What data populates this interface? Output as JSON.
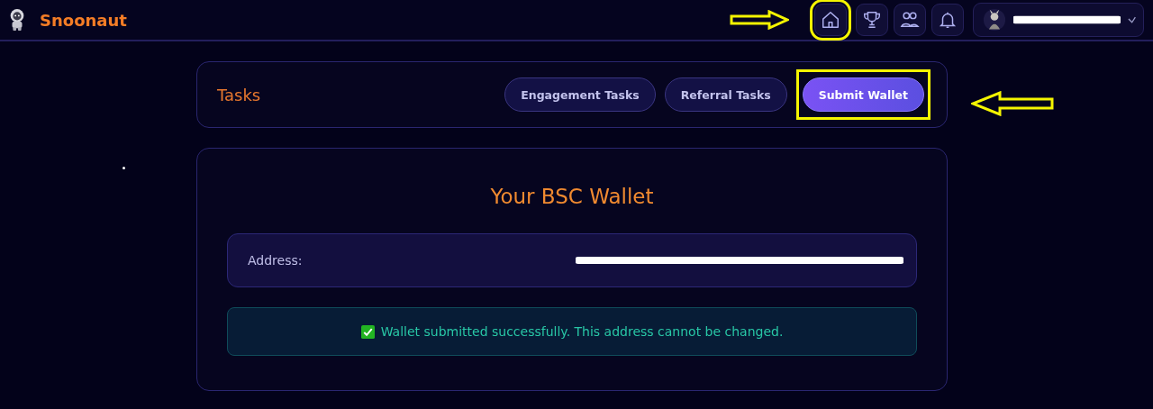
{
  "header": {
    "brand": "Snoonaut",
    "nav": [
      {
        "kind": "home",
        "highlighted": true
      },
      {
        "kind": "trophy",
        "highlighted": false
      },
      {
        "kind": "people",
        "highlighted": false
      },
      {
        "kind": "bell",
        "highlighted": false
      }
    ],
    "user": {
      "name_redacted": true
    }
  },
  "tasks": {
    "title": "Tasks",
    "tabs": [
      {
        "label": "Engagement Tasks",
        "selected": false,
        "highlighted": false
      },
      {
        "label": "Referral Tasks",
        "selected": false,
        "highlighted": false
      },
      {
        "label": "Submit Wallet",
        "selected": true,
        "highlighted": true
      }
    ]
  },
  "wallet": {
    "title": "Your BSC Wallet",
    "address_label": "Address:",
    "address_redacted": true,
    "message": {
      "kind": "success",
      "text": "Wallet submitted successfully. This address cannot be changed."
    }
  }
}
